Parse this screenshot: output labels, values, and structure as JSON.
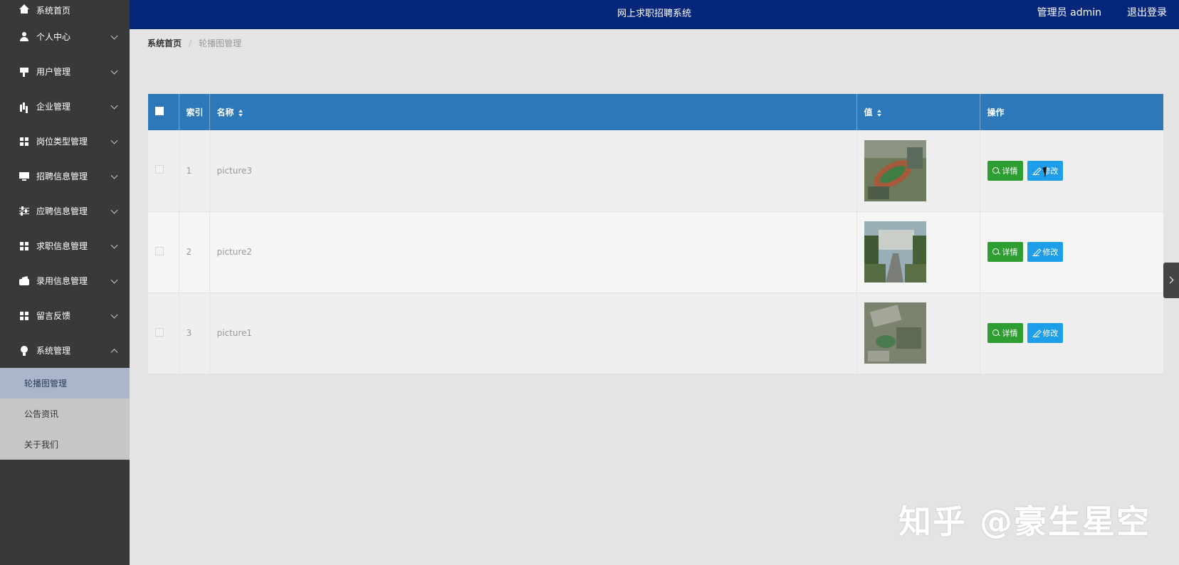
{
  "header": {
    "title": "网上求职招聘系统",
    "user": "管理员 admin",
    "logout": "退出登录"
  },
  "sidebar": {
    "items": [
      {
        "label": "系统首页",
        "icon": "home-icon"
      },
      {
        "label": "个人中心",
        "icon": "user-icon"
      },
      {
        "label": "用户管理",
        "icon": "flag-icon"
      },
      {
        "label": "企业管理",
        "icon": "bar-chart-icon"
      },
      {
        "label": "岗位类型管理",
        "icon": "grid-icon"
      },
      {
        "label": "招聘信息管理",
        "icon": "monitor-icon"
      },
      {
        "label": "应聘信息管理",
        "icon": "sliders-icon"
      },
      {
        "label": "求职信息管理",
        "icon": "grid-icon"
      },
      {
        "label": "录用信息管理",
        "icon": "wallet-icon"
      },
      {
        "label": "留言反馈",
        "icon": "grid-icon"
      },
      {
        "label": "系统管理",
        "icon": "bulb-icon"
      }
    ],
    "submenu": [
      "轮播图管理",
      "公告资讯",
      "关于我们"
    ]
  },
  "breadcrumb": {
    "home": "系统首页",
    "separator": "/",
    "current": "轮播图管理"
  },
  "table": {
    "headers": {
      "index": "索引",
      "name": "名称",
      "value": "值",
      "actions": "操作"
    },
    "rows": [
      {
        "index": "1",
        "name": "picture3"
      },
      {
        "index": "2",
        "name": "picture2"
      },
      {
        "index": "3",
        "name": "picture1"
      }
    ],
    "detail_label": "详情",
    "edit_label": "修改"
  },
  "watermark": "知乎 @豪生星空",
  "colors": {
    "header": "#06267a",
    "sidebar": "#393939",
    "table_head": "#2d78b8",
    "detail": "#2e9e33",
    "edit": "#1e9ee8"
  }
}
